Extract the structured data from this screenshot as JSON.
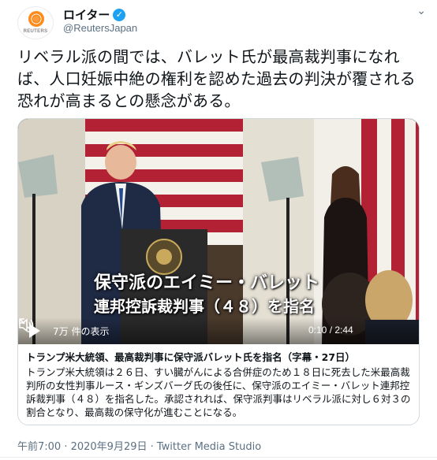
{
  "account": {
    "avatar_text": "REUTERS",
    "display_name": "ロイター",
    "handle": "@ReutersJapan",
    "verified": true
  },
  "tweet": {
    "text": "リベラル派の間では、バレット氏が最高裁判事になれば、人口妊娠中絶の権利を認めた過去の判決が覆される恐れが高まるとの懸念がある。"
  },
  "video": {
    "subtitle_line1": "保守派のエイミー・バレット",
    "subtitle_line2": "連邦控訴裁判事（４８）を指名",
    "views": "7万 件の表示",
    "time": "0:10 / 2:44"
  },
  "card": {
    "title": "トランプ米大統領、最高裁判事に保守派バレット氏を指名（字幕・27日）",
    "description": "トランプ米大統領は２６日、すい臓がんによる合併症のため１８日に死去した米最高裁判所の女性判事ルース・ギンズバーグ氏の後任に、保守派のエイミー・バレット連邦控訴裁判事（４８）を指名した。承認されれば、保守派判事はリベラル派に対し６対３の割合となり、最高裁の保守化が進むことになる。"
  },
  "meta": {
    "text": "午前7:00 · 2020年9月29日 · Twitter Media Studio"
  },
  "colors": {
    "accent": "#1da1f2",
    "secondary_text": "#5b7083",
    "border": "#cfd9de"
  }
}
